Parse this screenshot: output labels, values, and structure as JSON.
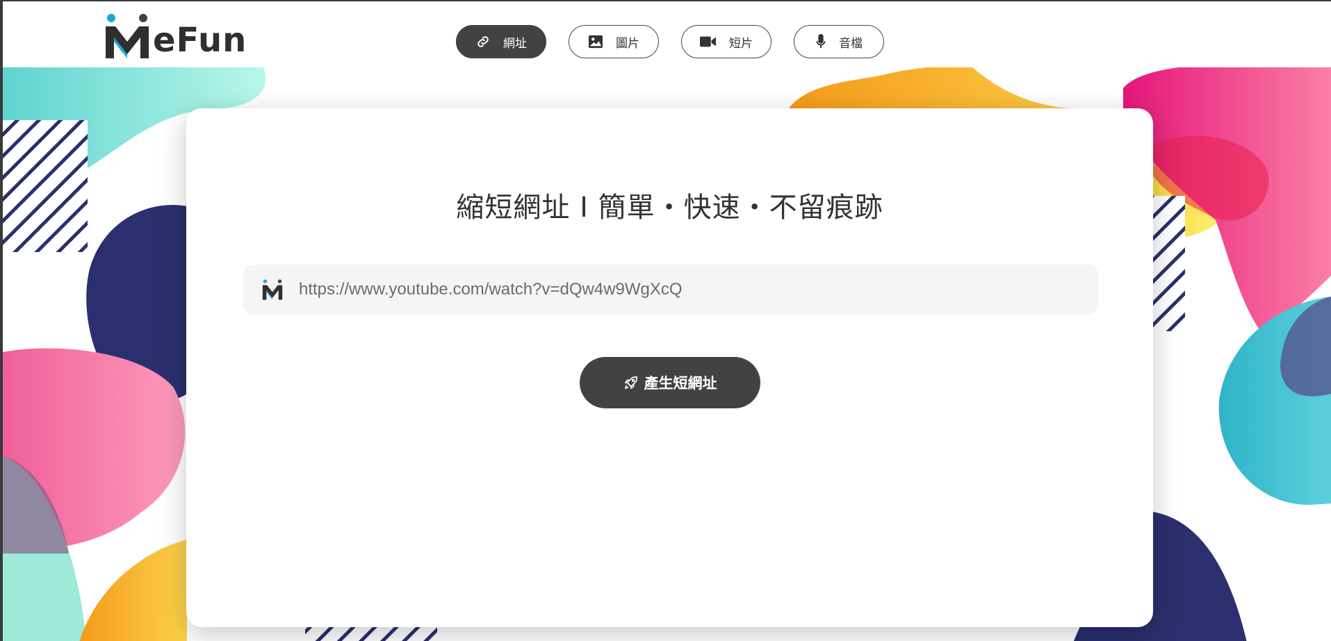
{
  "brand": {
    "logo_text": "eFun"
  },
  "nav": {
    "tabs": [
      {
        "label": "網址",
        "icon": "link-icon",
        "active": true
      },
      {
        "label": "圖片",
        "icon": "image-icon",
        "active": false
      },
      {
        "label": "短片",
        "icon": "video-icon",
        "active": false
      },
      {
        "label": "音檔",
        "icon": "microphone-icon",
        "active": false
      }
    ]
  },
  "main": {
    "title": "縮短網址 I 簡單・快速・不留痕跡",
    "url_value": "https://www.youtube.com/watch?v=dQw4w9WgXcQ",
    "generate_button_label": "產生短網址"
  },
  "colors": {
    "primary_dark": "#424242",
    "accent_blue": "#1ba8d8",
    "teal": "#7fe3d6",
    "navy": "#2b2f6e",
    "pink": "#f06aa0",
    "orange": "#f7a21c",
    "magenta": "#e8227a"
  }
}
